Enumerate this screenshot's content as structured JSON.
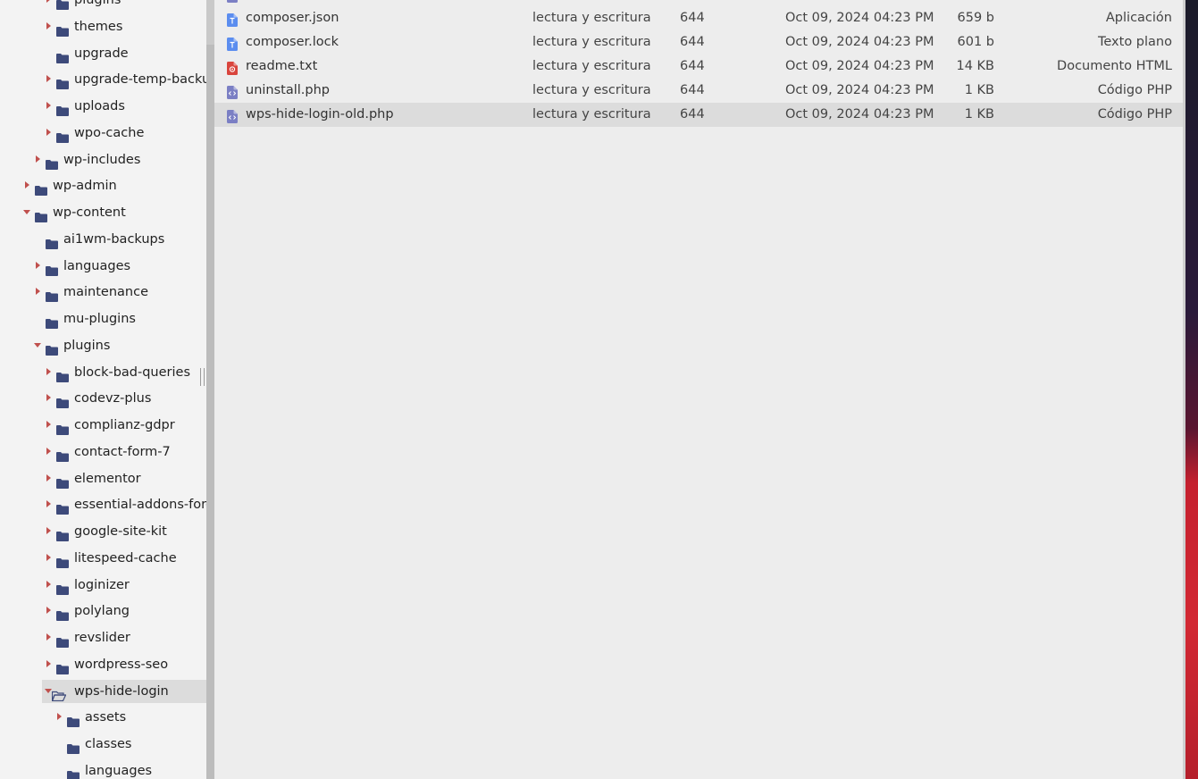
{
  "sidebar": {
    "items": [
      {
        "label": "plugins",
        "indent": 2,
        "state": "collapsed"
      },
      {
        "label": "themes",
        "indent": 2,
        "state": "collapsed"
      },
      {
        "label": "upgrade",
        "indent": 2,
        "state": "leaf"
      },
      {
        "label": "upgrade-temp-backup",
        "indent": 2,
        "state": "collapsed"
      },
      {
        "label": "uploads",
        "indent": 2,
        "state": "collapsed"
      },
      {
        "label": "wpo-cache",
        "indent": 2,
        "state": "collapsed"
      },
      {
        "label": "wp-includes",
        "indent": 1,
        "state": "collapsed"
      },
      {
        "label": "wp-admin",
        "indent": 0,
        "state": "collapsed"
      },
      {
        "label": "wp-content",
        "indent": 0,
        "state": "expanded"
      },
      {
        "label": "ai1wm-backups",
        "indent": 1,
        "state": "leaf"
      },
      {
        "label": "languages",
        "indent": 1,
        "state": "collapsed"
      },
      {
        "label": "maintenance",
        "indent": 1,
        "state": "collapsed"
      },
      {
        "label": "mu-plugins",
        "indent": 1,
        "state": "leaf"
      },
      {
        "label": "plugins",
        "indent": 1,
        "state": "expanded"
      },
      {
        "label": "block-bad-queries",
        "indent": 2,
        "state": "collapsed"
      },
      {
        "label": "codevz-plus",
        "indent": 2,
        "state": "collapsed"
      },
      {
        "label": "complianz-gdpr",
        "indent": 2,
        "state": "collapsed"
      },
      {
        "label": "contact-form-7",
        "indent": 2,
        "state": "collapsed"
      },
      {
        "label": "elementor",
        "indent": 2,
        "state": "collapsed"
      },
      {
        "label": "essential-addons-for-elementor-lite",
        "indent": 2,
        "state": "collapsed"
      },
      {
        "label": "google-site-kit",
        "indent": 2,
        "state": "collapsed"
      },
      {
        "label": "litespeed-cache",
        "indent": 2,
        "state": "collapsed"
      },
      {
        "label": "loginizer",
        "indent": 2,
        "state": "collapsed"
      },
      {
        "label": "polylang",
        "indent": 2,
        "state": "collapsed"
      },
      {
        "label": "revslider",
        "indent": 2,
        "state": "collapsed"
      },
      {
        "label": "wordpress-seo",
        "indent": 2,
        "state": "collapsed"
      },
      {
        "label": "wps-hide-login",
        "indent": 2,
        "state": "open-selected"
      },
      {
        "label": "assets",
        "indent": 3,
        "state": "collapsed"
      },
      {
        "label": "classes",
        "indent": 3,
        "state": "leaf"
      },
      {
        "label": "languages",
        "indent": 3,
        "state": "leaf"
      }
    ]
  },
  "files": {
    "rows": [
      {
        "name": "composer.json",
        "perm": "lectura y escritura",
        "mode": "644",
        "date": "Oct 09, 2024 04:23 PM",
        "size": "659 b",
        "type": "Aplicación",
        "icon": "text-file-icon"
      },
      {
        "name": "composer.lock",
        "perm": "lectura y escritura",
        "mode": "644",
        "date": "Oct 09, 2024 04:23 PM",
        "size": "601 b",
        "type": "Texto plano",
        "icon": "text-file-icon"
      },
      {
        "name": "readme.txt",
        "perm": "lectura y escritura",
        "mode": "644",
        "date": "Oct 09, 2024 04:23 PM",
        "size": "14 KB",
        "type": "Documento HTML",
        "icon": "html-file-icon"
      },
      {
        "name": "uninstall.php",
        "perm": "lectura y escritura",
        "mode": "644",
        "date": "Oct 09, 2024 04:23 PM",
        "size": "1 KB",
        "type": "Código PHP",
        "icon": "php-file-icon"
      },
      {
        "name": "wps-hide-login-old.php",
        "perm": "lectura y escritura",
        "mode": "644",
        "date": "Oct 09, 2024 04:23 PM",
        "size": "1 KB",
        "type": "Código PHP",
        "icon": "php-file-icon",
        "selected": true
      }
    ]
  },
  "colors": {
    "folder": "#3d4a7a",
    "caret": "#c0504d",
    "text_file": "#5b8def",
    "html_file": "#d9453d",
    "php_file": "#7b7fc4",
    "selection": "#dcdcdc"
  }
}
